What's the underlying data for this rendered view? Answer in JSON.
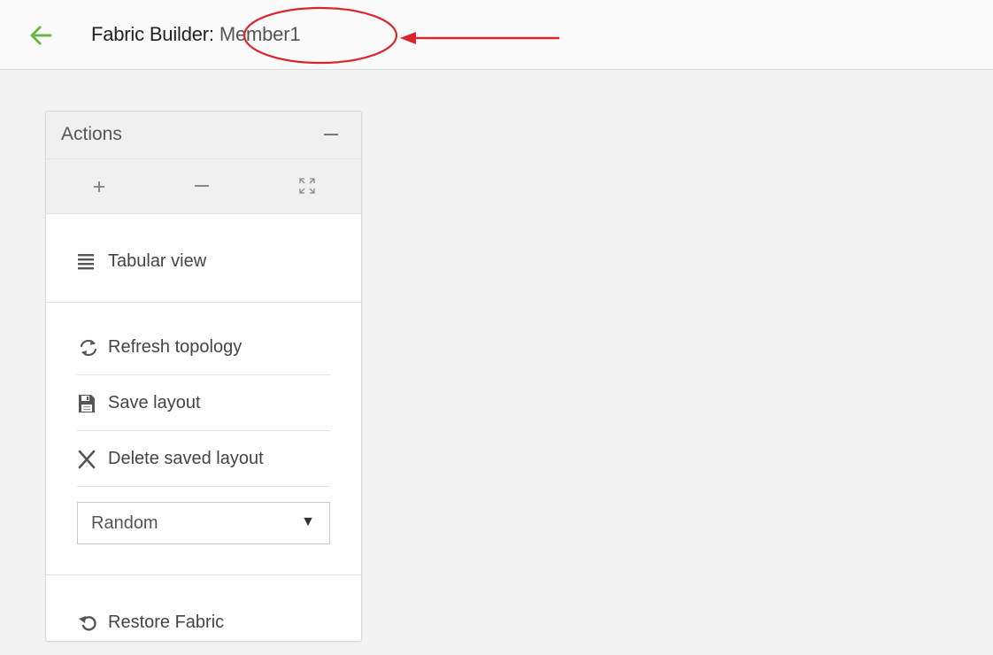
{
  "header": {
    "back_icon": "arrow-left-icon",
    "title_label": "Fabric Builder:",
    "member_name": "Member1",
    "accent_color": "#6bb846",
    "annotation_color": "#d9262c"
  },
  "panel": {
    "title": "Actions",
    "zoom_controls": [
      "zoom-in-icon",
      "zoom-out-icon",
      "fit-to-screen-icon"
    ],
    "tabular_view": {
      "label": "Tabular view",
      "icon": "list-icon"
    },
    "refresh": {
      "label": "Refresh topology",
      "icon": "refresh-icon"
    },
    "save": {
      "label": "Save layout",
      "icon": "save-icon"
    },
    "delete": {
      "label": "Delete saved layout",
      "icon": "close-icon"
    },
    "layout_select": {
      "value": "Random",
      "caret": "▼"
    },
    "restore": {
      "label": "Restore Fabric",
      "icon": "restore-icon"
    }
  }
}
